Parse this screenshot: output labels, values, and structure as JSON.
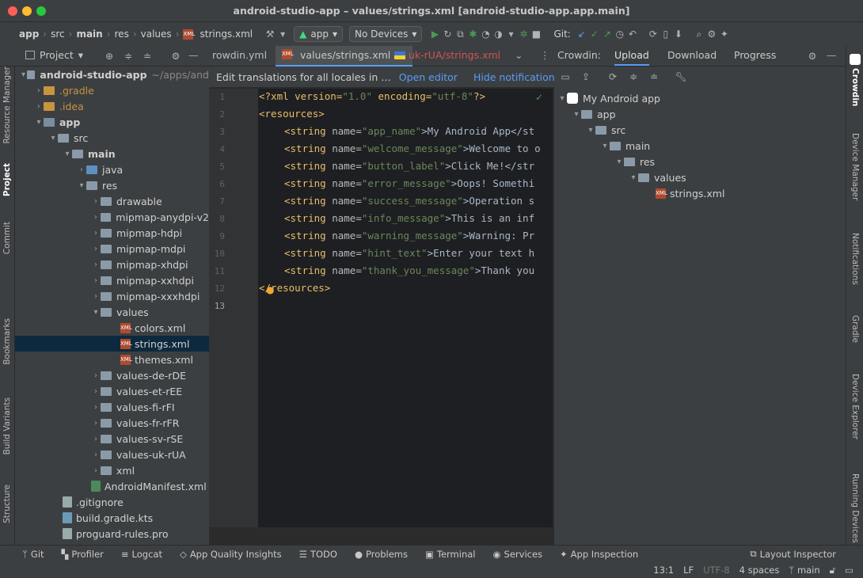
{
  "window": {
    "title": "android-studio-app – values/strings.xml [android-studio-app.app.main]"
  },
  "toolbar": {
    "breadcrumbs": [
      "app",
      "src",
      "main",
      "res",
      "values",
      "strings.xml"
    ],
    "run_config": "app",
    "device": "No Devices",
    "git_label": "Git:"
  },
  "tabs": {
    "items": [
      {
        "label": "rowdin.yml"
      },
      {
        "label": "values/strings.xml"
      },
      {
        "label": "uk-rUA/strings.xml"
      }
    ],
    "project_label": "Project"
  },
  "crowdin_tabs": {
    "label": "Crowdin:",
    "items": [
      "Upload",
      "Download",
      "Progress"
    ]
  },
  "notification": {
    "text": "Edit translations for all locales in …",
    "open_editor": "Open editor",
    "hide": "Hide notification"
  },
  "project_tree": {
    "root": "android-studio-app",
    "root_path": "~/apps/and",
    "items": [
      {
        "label": ".gradle"
      },
      {
        "label": ".idea"
      },
      {
        "label": "app"
      },
      {
        "label": "src"
      },
      {
        "label": "main"
      },
      {
        "label": "java"
      },
      {
        "label": "res"
      },
      {
        "label": "drawable"
      },
      {
        "label": "mipmap-anydpi-v2"
      },
      {
        "label": "mipmap-hdpi"
      },
      {
        "label": "mipmap-mdpi"
      },
      {
        "label": "mipmap-xhdpi"
      },
      {
        "label": "mipmap-xxhdpi"
      },
      {
        "label": "mipmap-xxxhdpi"
      },
      {
        "label": "values"
      },
      {
        "label": "colors.xml"
      },
      {
        "label": "strings.xml"
      },
      {
        "label": "themes.xml"
      },
      {
        "label": "values-de-rDE"
      },
      {
        "label": "values-et-rEE"
      },
      {
        "label": "values-fi-rFI"
      },
      {
        "label": "values-fr-rFR"
      },
      {
        "label": "values-sv-rSE"
      },
      {
        "label": "values-uk-rUA"
      },
      {
        "label": "xml"
      },
      {
        "label": "AndroidManifest.xml"
      },
      {
        "label": ".gitignore"
      },
      {
        "label": "build.gradle.kts"
      },
      {
        "label": "proguard-rules.pro"
      }
    ]
  },
  "code": {
    "line_numbers": [
      "1",
      "2",
      "3",
      "4",
      "5",
      "6",
      "7",
      "8",
      "9",
      "10",
      "11",
      "12",
      "13"
    ],
    "lines": [
      {
        "p1": "<?xml version=",
        "v1": "\"1.0\"",
        "p2": " encoding=",
        "v2": "\"utf-8\"",
        "p3": "?>"
      },
      {
        "tag": "<resources>"
      },
      {
        "name": "\"app_name\"",
        "text": ">My Android App</st"
      },
      {
        "name": "\"welcome_message\"",
        "text": ">Welcome to o"
      },
      {
        "name": "\"button_label\"",
        "text": ">Click Me!</str"
      },
      {
        "name": "\"error_message\"",
        "text": ">Oops! Somethi"
      },
      {
        "name": "\"success_message\"",
        "text": ">Operation s"
      },
      {
        "name": "\"info_message\"",
        "text": ">This is an inf"
      },
      {
        "name": "\"warning_message\"",
        "text": ">Warning: Pr"
      },
      {
        "name": "\"hint_text\"",
        "text": ">Enter your text h"
      },
      {
        "name": "\"thank_you_message\"",
        "text": ">Thank you"
      },
      {
        "tag": "</resources>"
      }
    ],
    "string_open": "<string name=",
    "string_kw": "<string",
    "name_kw": "name="
  },
  "crowdin_tree": {
    "root": "My Android app",
    "items": [
      "app",
      "src",
      "main",
      "res",
      "values",
      "strings.xml"
    ]
  },
  "left_strip": [
    "Resource Manager",
    "Project",
    "Commit",
    "Bookmarks",
    "Build Variants",
    "Structure"
  ],
  "right_strip": [
    "Crowdin",
    "Device Manager",
    "Notifications",
    "Gradle",
    "Device Explorer",
    "Running Devices"
  ],
  "statusbar": {
    "items": [
      "Git",
      "Profiler",
      "Logcat",
      "App Quality Insights",
      "TODO",
      "Problems",
      "Terminal",
      "Services",
      "App Inspection"
    ],
    "layout_inspector": "Layout Inspector"
  },
  "bottombar": {
    "position": "13:1",
    "line_sep": "LF",
    "encoding": "UTF-8",
    "indent": "4 spaces",
    "branch": "main"
  },
  "colors": {
    "accent": "#589df6",
    "green": "#499c54",
    "tree_selection": "#0d293e"
  }
}
